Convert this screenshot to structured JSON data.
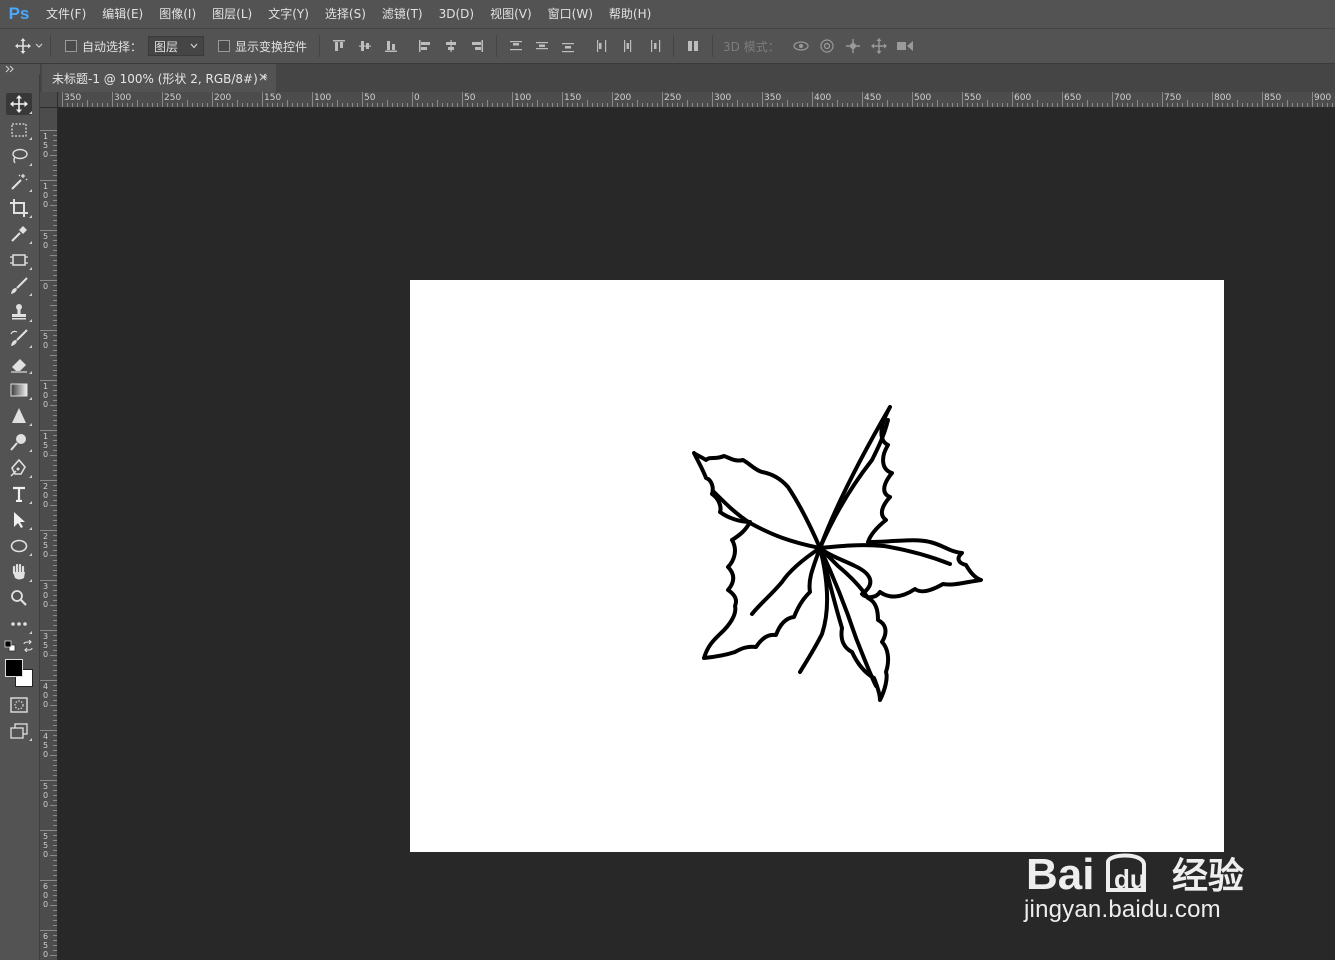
{
  "app": {
    "logo": "Ps"
  },
  "menu": [
    "文件(F)",
    "编辑(E)",
    "图像(I)",
    "图层(L)",
    "文字(Y)",
    "选择(S)",
    "滤镜(T)",
    "3D(D)",
    "视图(V)",
    "窗口(W)",
    "帮助(H)"
  ],
  "options": {
    "auto_select_label": "自动选择：",
    "auto_select_value": "图层",
    "show_transform_label": "显示变换控件",
    "mode_3d_label": "3D 模式："
  },
  "tab": {
    "title": "未标题-1 @ 100% (形状 2, RGB/8#) *",
    "close": "×"
  },
  "ruler_top_labels": [
    "350",
    "300",
    "250",
    "200",
    "150",
    "100",
    "50",
    "0",
    "50",
    "100",
    "150",
    "200",
    "250",
    "300",
    "350",
    "400",
    "450",
    "500",
    "550",
    "600",
    "650",
    "700",
    "750",
    "800",
    "850",
    "900"
  ],
  "ruler_left_labels": [
    "150",
    "100",
    "50",
    "0",
    "50",
    "100",
    "150",
    "200",
    "250",
    "300",
    "350",
    "400",
    "450",
    "500",
    "550",
    "600",
    "650"
  ],
  "tools": [
    "move-tool",
    "marquee-tool",
    "lasso-tool",
    "magic-wand-tool",
    "crop-tool",
    "eyedropper-tool",
    "frame-tool",
    "brush-tool",
    "stamp-tool",
    "history-brush-tool",
    "eraser-tool",
    "gradient-tool",
    "sharpen-tool",
    "dodge-tool",
    "pen-tool",
    "type-tool",
    "path-selection-tool",
    "ellipse-tool",
    "hand-tool",
    "zoom-tool",
    "more-tools"
  ],
  "colors": {
    "foreground": "#000000",
    "background": "#ffffff",
    "panel": "#535353",
    "workspace": "#282828"
  },
  "watermark": {
    "text": "jingyan.baidu.com",
    "brand": "Baidu经验"
  }
}
